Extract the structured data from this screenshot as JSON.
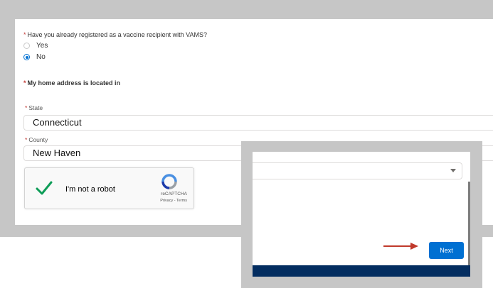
{
  "form": {
    "registered_question": "Have you already registered as a vaccine recipient with VAMS?",
    "required_marker": "*",
    "options": [
      {
        "label": "Yes",
        "checked": false
      },
      {
        "label": "No",
        "checked": true
      }
    ],
    "home_address_heading": "My home address is located in",
    "state": {
      "label": "State",
      "value": "Connecticut"
    },
    "county": {
      "label": "County",
      "value": "New Haven"
    }
  },
  "captcha": {
    "label": "I'm not a robot",
    "brand": "reCAPTCHA",
    "links": "Privacy - Terms",
    "check_color": "#0f9d58"
  },
  "popup": {
    "next_label": "Next",
    "accent": "#0070d2",
    "footer_color": "#032d60",
    "arrow_color": "#c0392b"
  }
}
